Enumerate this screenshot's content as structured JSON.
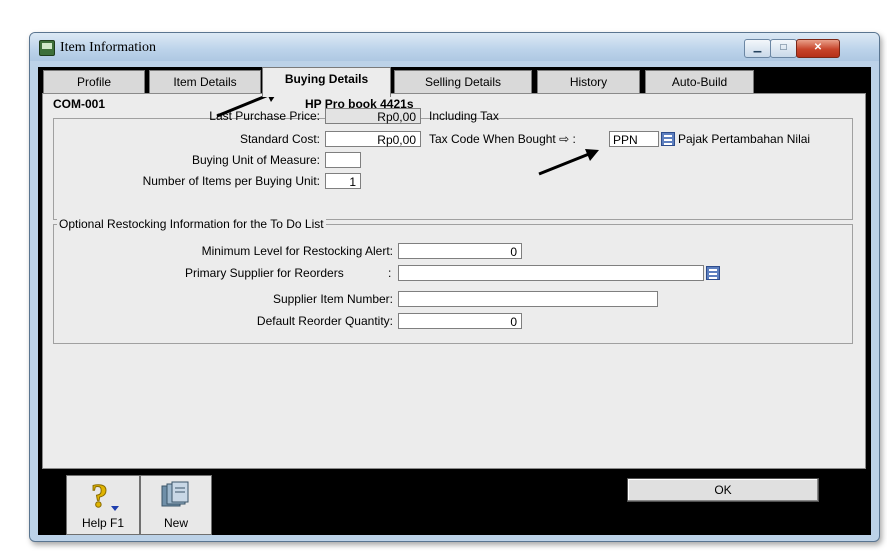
{
  "window": {
    "title": "Item Information"
  },
  "tabs": [
    {
      "label": "Profile"
    },
    {
      "label": "Item Details"
    },
    {
      "label": "Buying Details"
    },
    {
      "label": "Selling Details"
    },
    {
      "label": "History"
    },
    {
      "label": "Auto-Build"
    }
  ],
  "item": {
    "code": "COM-001",
    "name": "HP Pro book 4421s"
  },
  "buying": {
    "last_purchase_price_label": "Last Purchase Price:",
    "last_purchase_price": "Rp0,00",
    "including_tax": "Including Tax",
    "standard_cost_label": "Standard Cost:",
    "standard_cost": "Rp0,00",
    "tax_code_label": "Tax Code When Bought ⇨ :",
    "tax_code": "PPN",
    "tax_code_desc": "Pajak Pertambahan Nilai",
    "buying_unit_label": "Buying Unit of Measure:",
    "buying_unit": "",
    "items_per_unit_label": "Number of Items per Buying Unit:",
    "items_per_unit": "1"
  },
  "restock": {
    "legend": "Optional Restocking Information for the To Do List",
    "min_level_label": "Minimum Level for Restocking Alert:",
    "min_level": "0",
    "primary_supplier_label": "Primary Supplier for Reorders",
    "primary_supplier_colon": ":",
    "primary_supplier": "",
    "supplier_item_label": "Supplier Item Number:",
    "supplier_item": "",
    "reorder_qty_label": "Default Reorder Quantity:",
    "reorder_qty": "0"
  },
  "buttons": {
    "help": "Help F1",
    "new": "New",
    "ok": "OK"
  },
  "icons": [
    "window-app-icon",
    "minimize-icon",
    "maximize-icon",
    "close-icon",
    "dropdown-icon",
    "help-icon",
    "new-icon",
    "arrow-annotation-icon"
  ]
}
